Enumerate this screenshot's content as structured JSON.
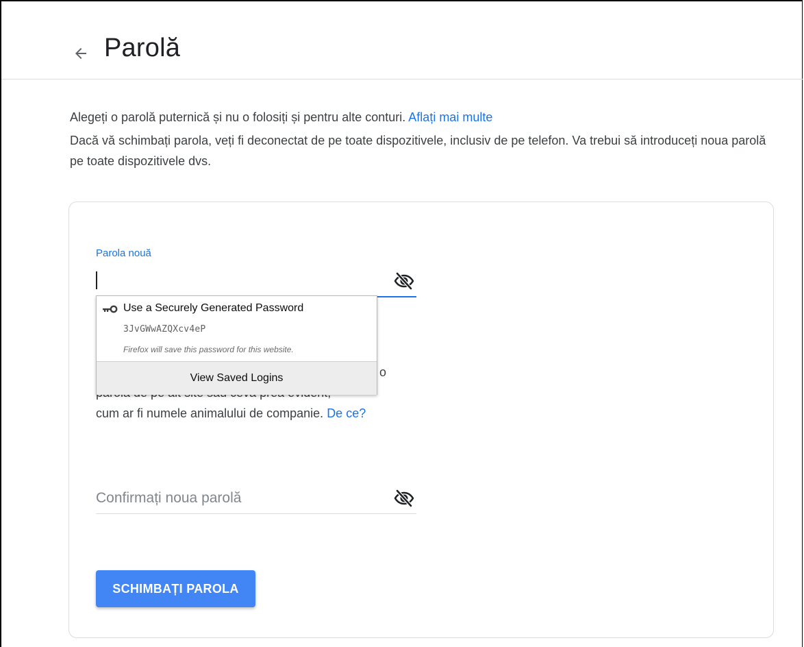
{
  "header": {
    "title": "Parolă"
  },
  "intro": {
    "line1_text": "Alegeți o parolă puternică și nu o folosiți și pentru alte conturi.",
    "line1_link": "Aflați mai multe",
    "line2_text": "Dacă vă schimbați parola, veți fi deconectat de pe toate dispozitivele, inclusiv de pe telefon. Va trebui să introduceți noua parolă pe toate dispozitivele dvs."
  },
  "form": {
    "new_password_label": "Parola nouă",
    "new_password_value": "",
    "hint_line1": "o",
    "hint_line2": "parola de pe alt site sau ceva prea evident,",
    "hint_line3": "cum ar fi numele animalului de companie.",
    "hint_link": "De ce?",
    "confirm_placeholder": "Confirmați noua parolă",
    "submit_label": "SCHIMBAȚI PAROLA"
  },
  "autofill_popup": {
    "title": "Use a Securely Generated Password",
    "generated_password": "3JvGWwAZQXcv4eP",
    "note": "Firefox will save this password for this website.",
    "footer_label": "View Saved Logins",
    "icon": "key-icon"
  },
  "colors": {
    "accent": "#1a73e8",
    "button": "#4285f4",
    "border": "#dadce0"
  }
}
